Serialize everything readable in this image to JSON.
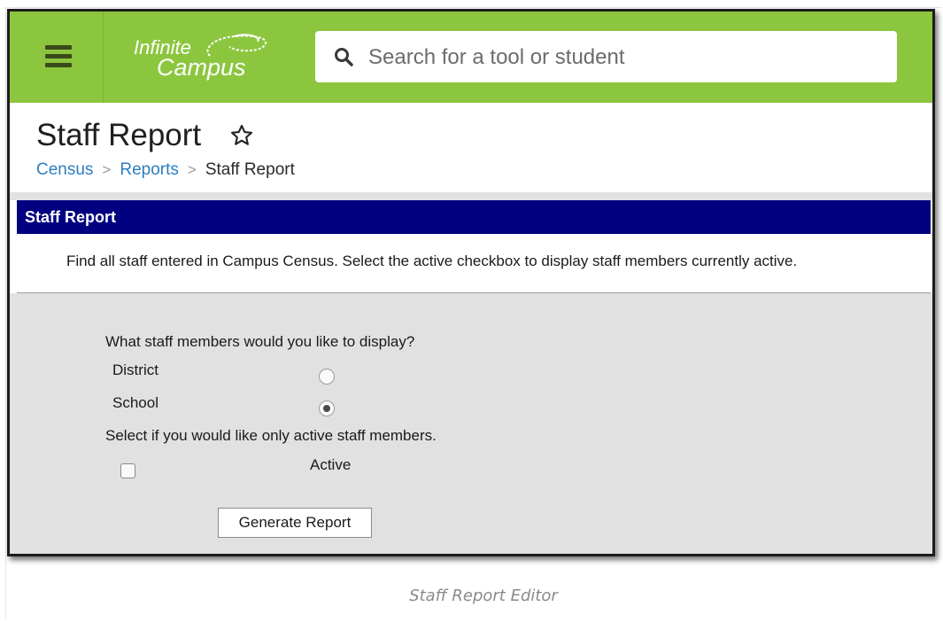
{
  "header": {
    "menu_icon": "hamburger-menu-icon",
    "logo": {
      "line1": "Infinite",
      "line2": "Campus"
    },
    "search": {
      "placeholder": "Search for a tool or student",
      "icon": "search-icon"
    }
  },
  "page": {
    "title": "Staff Report",
    "favorite_icon": "star-outline-icon",
    "breadcrumb": [
      "Census",
      "Reports",
      "Staff Report"
    ]
  },
  "report": {
    "header": "Staff Report",
    "description": "Find all staff entered in Campus Census. Select the active checkbox to display staff members currently active.",
    "question1": "What staff members would you like to display?",
    "options": [
      {
        "label": "District",
        "selected": false
      },
      {
        "label": "School",
        "selected": true
      }
    ],
    "question2": "Select if you would like only active staff members.",
    "active_label": "Active",
    "active_checked": false,
    "generate_button": "Generate Report"
  },
  "caption": "Staff Report Editor",
  "colors": {
    "topbar": "#8cc63f",
    "report_header": "#000080",
    "link": "#2e7dc0",
    "form_bg": "#e1e1e1"
  }
}
